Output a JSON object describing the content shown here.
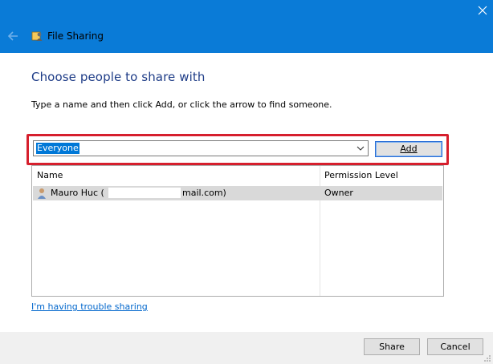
{
  "window": {
    "title": "File Sharing",
    "titlebar_color": "#0a7bd7"
  },
  "main": {
    "heading": "Choose people to share with",
    "instruction": "Type a name and then click Add, or click the arrow to find someone.",
    "combo_value": "Everyone",
    "add_label": "Add"
  },
  "list": {
    "columns": [
      "Name",
      "Permission Level"
    ],
    "rows": [
      {
        "name_prefix": "Mauro Huc (",
        "name_suffix": "mail.com)",
        "permission": "Owner"
      }
    ]
  },
  "trouble_link": "I'm having trouble sharing",
  "footer": {
    "share_label": "Share",
    "cancel_label": "Cancel"
  },
  "accent_colors": {
    "highlight": "#d61f2d",
    "heading": "#1e3c87",
    "link": "#0066cc"
  }
}
